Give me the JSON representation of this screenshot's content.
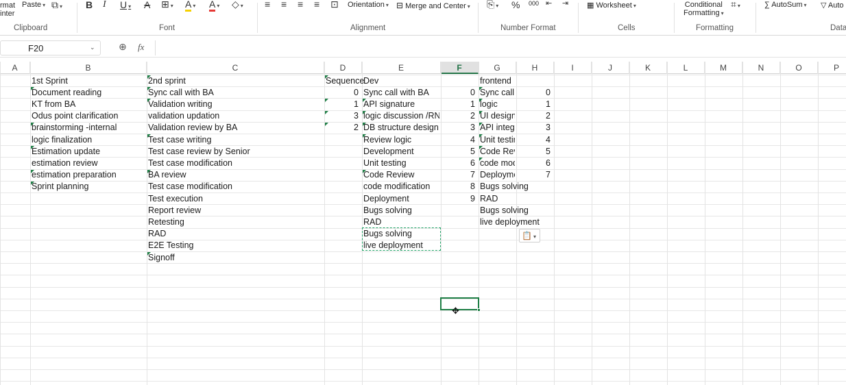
{
  "ribbon": {
    "clipboard": {
      "format_painter_partial": "rmat",
      "format_painter_partial2": "inter",
      "paste_label": "Paste",
      "group_label": "Clipboard"
    },
    "font": {
      "group_label": "Font",
      "bold": "B",
      "italic": "I",
      "underline": "U",
      "font_color": "#e53935",
      "highlight_color": "#f5d000"
    },
    "alignment": {
      "orientation_label": "Orientation",
      "merge_label": "Merge and Center",
      "group_label": "Alignment"
    },
    "number": {
      "percent": "%",
      "thousands": "000",
      "dec_inc": "+.0\n.00",
      "dec_dec": ".00\n→.0",
      "group_label": "Number Format"
    },
    "cells": {
      "worksheet_label": "Worksheet",
      "group_label": "Cells"
    },
    "formatting": {
      "conditional_label_1": "Conditional",
      "conditional_label_2": "Formatting",
      "group_label": "Formatting"
    },
    "data": {
      "autosum_label": "AutoSum",
      "auto_partial": "Auto",
      "group_label": "Data"
    }
  },
  "formula_bar": {
    "name_box": "F20",
    "fx": "fx",
    "formula": ""
  },
  "columns": [
    "A",
    "B",
    "C",
    "D",
    "E",
    "F",
    "G",
    "H",
    "I",
    "J",
    "K",
    "L",
    "M",
    "N",
    "O",
    "P"
  ],
  "selected_column": "F",
  "cells": {
    "B": [
      "1st Sprint",
      "Document reading",
      "KT from BA",
      "Odus point clarification",
      "brainstorming -internal",
      "logic finalization",
      "Estimation update",
      "estimation review",
      "estimation preparation",
      "Sprint planning"
    ],
    "C": [
      "2nd sprint",
      "Sync call with BA",
      "Validation writing",
      "validation updation",
      "Validation review by BA",
      "Test case writing",
      "Test case review by Senior",
      "Test case modification",
      "BA review",
      "Test case modification",
      "Test execution",
      "Report review",
      "Retesting",
      "RAD",
      "E2E Testing",
      "Signoff"
    ],
    "D": [
      "Sequence",
      "0",
      "1",
      "3",
      "2"
    ],
    "E": [
      "Dev",
      "Sync call with BA",
      "API signature",
      "logic discussion /RND",
      "DB structure design /t",
      "Review logic",
      "Development",
      "Unit testing",
      "Code Review",
      "code modification",
      "Deployment",
      "Bugs solving",
      "RAD",
      "Bugs solving",
      "live deployment"
    ],
    "F": [
      "",
      "0",
      "1",
      "2",
      "3",
      "4",
      "5",
      "6",
      "7",
      "8",
      "9"
    ],
    "G": [
      "frontend",
      "Sync call w",
      "logic",
      "UI design",
      "API integr",
      "Unit testir",
      "Code Revi",
      "code mod",
      "Deployme",
      "Bugs solving",
      "RAD",
      "Bugs solving",
      "live deployment"
    ],
    "H": [
      "",
      "0",
      "1",
      "2",
      "3",
      "4",
      "5",
      "6",
      "7"
    ]
  }
}
